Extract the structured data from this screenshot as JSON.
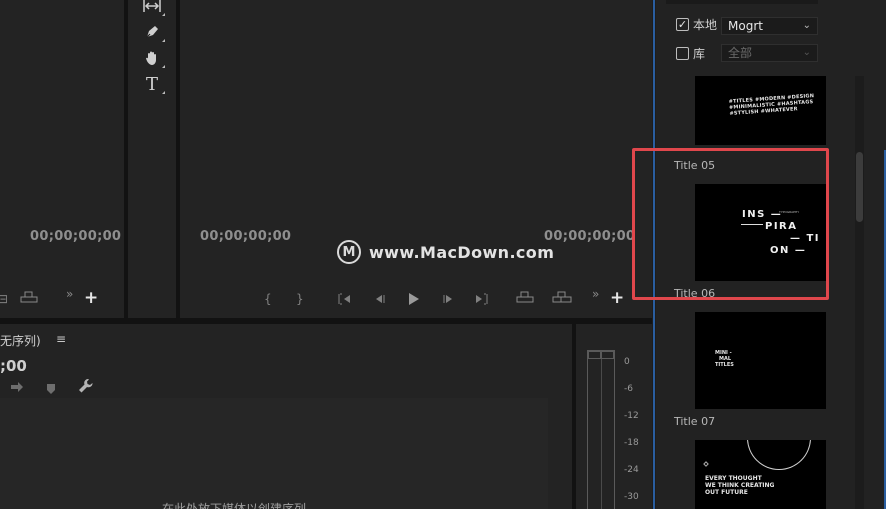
{
  "source_monitor": {
    "timecode": "00;00;00;00",
    "add_label": "+",
    "overflow_label": "»"
  },
  "tools": [
    {
      "name": "track-select-icon",
      "glyph": "↔"
    },
    {
      "name": "pen-tool-icon",
      "glyph": "✒"
    },
    {
      "name": "hand-tool-icon",
      "glyph": "✋"
    },
    {
      "name": "type-tool-icon",
      "glyph": "T"
    }
  ],
  "program_monitor": {
    "timecode_left": "00;00;00;00",
    "timecode_right": "00;00;00;00",
    "controls": {
      "mark_in": "{",
      "mark_out": "}",
      "go_to_in": "{←",
      "step_back": "◂|",
      "play": "▶",
      "step_forward": "|▸",
      "go_to_out": "→}",
      "overflow": "»",
      "add": "+"
    }
  },
  "watermark": {
    "logo_letter": "M",
    "text": "www.MacDown.com"
  },
  "project_panel": {
    "title": "无序列)",
    "menu": "≡",
    "timecode": ";00",
    "drop_hint": "在此处放下媒体以创建序列"
  },
  "meter": {
    "db_labels": [
      "0",
      "-6",
      "-12",
      "-18",
      "-24",
      "-30"
    ]
  },
  "graphics_panel": {
    "local_checkbox": {
      "checked": true,
      "label": "本地"
    },
    "local_select": "Mogrt",
    "library_checkbox": {
      "checked": false,
      "label": "库"
    },
    "library_select": "全部",
    "templates": [
      {
        "label": "",
        "preview_lines": [
          "#TITLES #MODERN #DESIGN",
          "#MINIMALISTIC #HASHTAGS",
          "#STYLISH #WHATEVER"
        ]
      },
      {
        "label": "Title 05",
        "preview_lines": [
          "INS —",
          "PIRA",
          "— TI",
          "ON —"
        ],
        "small_line": "TYPOGRAPHY"
      },
      {
        "label": "Title 06",
        "preview_lines": [
          "MINI -",
          "MAL",
          "TITLES"
        ]
      },
      {
        "label": "Title 07",
        "preview_lines": [
          "EVERY THOUGHT",
          "WE THINK CREATING",
          "OUT FUTURE"
        ]
      }
    ]
  },
  "colors": {
    "highlight": "#e0474c",
    "panel_edge": "#2a5ea0"
  }
}
